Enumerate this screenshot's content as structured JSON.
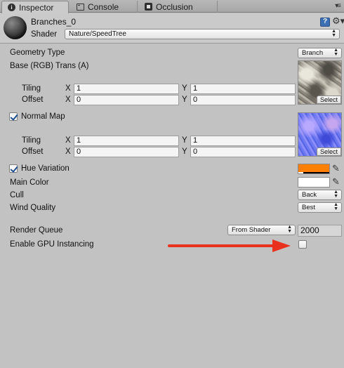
{
  "tabs": [
    {
      "label": "Inspector",
      "icon": "info-icon",
      "active": true
    },
    {
      "label": "Console",
      "icon": "console-icon",
      "active": false
    },
    {
      "label": "Occlusion",
      "icon": "occlusion-icon",
      "active": false
    }
  ],
  "material": {
    "name": "Branches_0",
    "shader_label": "Shader",
    "shader_value": "Nature/SpeedTree"
  },
  "properties": {
    "geometry_type": {
      "label": "Geometry Type",
      "value": "Branch"
    },
    "base_map": {
      "label": "Base (RGB) Trans (A)",
      "tiling": {
        "label": "Tiling",
        "x": "1",
        "y": "1"
      },
      "offset": {
        "label": "Offset",
        "x": "0",
        "y": "0"
      },
      "select_label": "Select"
    },
    "normal_map": {
      "label": "Normal Map",
      "checked": true,
      "tiling": {
        "label": "Tiling",
        "x": "1",
        "y": "1"
      },
      "offset": {
        "label": "Offset",
        "x": "0",
        "y": "0"
      },
      "select_label": "Select"
    },
    "hue_variation": {
      "label": "Hue Variation",
      "checked": true,
      "color": "#ff8000"
    },
    "main_color": {
      "label": "Main Color",
      "color": "#ffffff"
    },
    "cull": {
      "label": "Cull",
      "value": "Back"
    },
    "wind_quality": {
      "label": "Wind Quality",
      "value": "Best"
    },
    "render_queue": {
      "label": "Render Queue",
      "mode": "From Shader",
      "value": "2000"
    },
    "gpu_instancing": {
      "label": "Enable GPU Instancing",
      "checked": false
    }
  },
  "axis_labels": {
    "x": "X",
    "y": "Y"
  },
  "annotation": {
    "arrow_color": "#e8321e"
  }
}
